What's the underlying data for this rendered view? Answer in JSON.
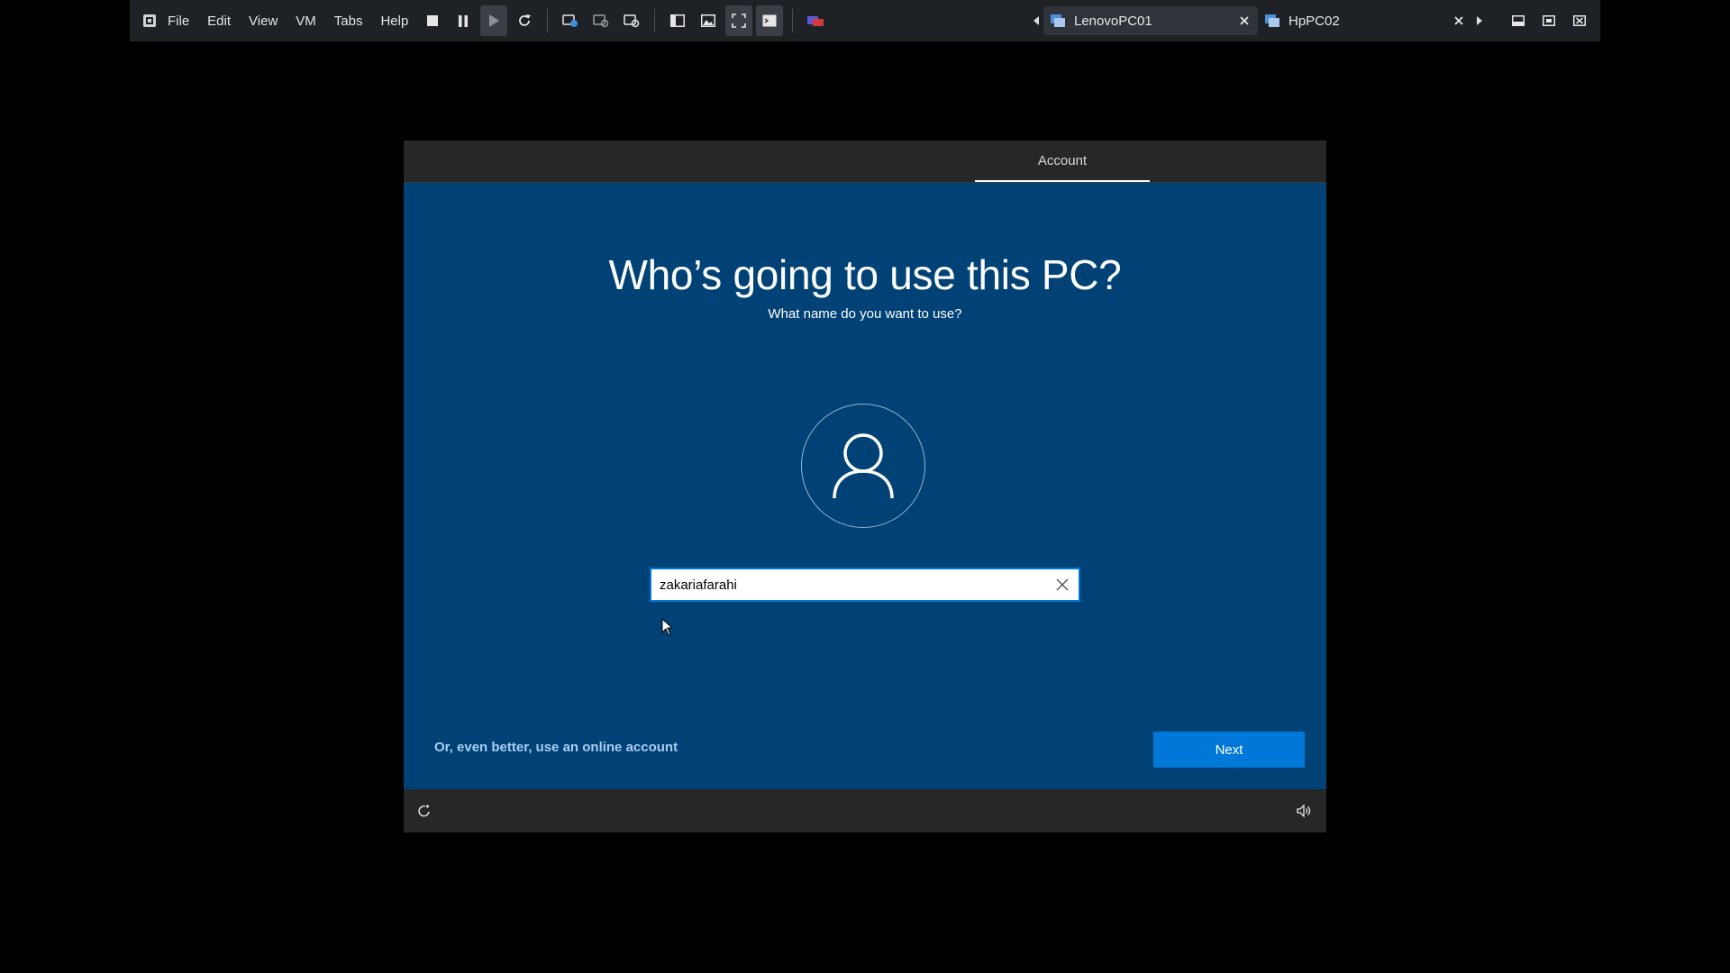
{
  "toolbar": {
    "menu": [
      "File",
      "Edit",
      "View",
      "VM",
      "Tabs",
      "Help"
    ],
    "tabs": [
      {
        "label": "LenovoPC01",
        "active": true
      },
      {
        "label": "HpPC02",
        "active": false
      }
    ]
  },
  "oobe": {
    "header_tab": "Account",
    "title": "Who’s going to use this PC?",
    "subtitle": "What name do you want to use?",
    "name_value": "zakariafarahi",
    "online_link": "Or, even better, use an online account",
    "next_label": "Next"
  },
  "colors": {
    "oobe_background": "#004275",
    "accent": "#0078d7",
    "header_footer": "#272727",
    "link": "#a8cdf0"
  }
}
